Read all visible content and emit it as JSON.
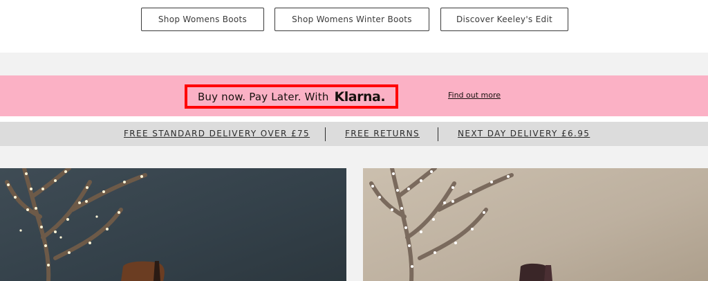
{
  "cta_buttons": [
    {
      "label": "Shop Womens Boots"
    },
    {
      "label": "Shop Womens Winter Boots"
    },
    {
      "label": "Discover Keeley's Edit"
    }
  ],
  "klarna": {
    "text": "Buy now. Pay Later. With",
    "logo": "Klarna.",
    "find_more": "Find out more",
    "background": "#fbb1c5",
    "highlight_border": "#ff0000"
  },
  "delivery": [
    {
      "label": "FREE STANDARD DELIVERY OVER £75"
    },
    {
      "label": "FREE RETURNS"
    },
    {
      "label": "NEXT DAY DELIVERY £6.95"
    }
  ],
  "images": [
    {
      "name": "product-image-left",
      "icon": "branch-with-fairy-lights-and-boot"
    },
    {
      "name": "product-image-right",
      "icon": "branch-with-fairy-lights-and-boot"
    }
  ]
}
